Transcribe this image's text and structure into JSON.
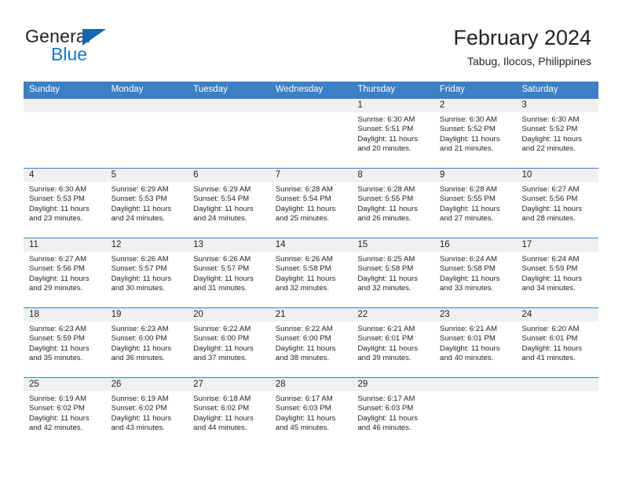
{
  "brand": {
    "name_top": "General",
    "name_bottom": "Blue",
    "triangle_color": "#1565b0",
    "blue_color": "#1877c4"
  },
  "header": {
    "title": "February 2024",
    "subtitle": "Tabug, Ilocos, Philippines"
  },
  "theme": {
    "header_bar_color": "#3b7fc4",
    "daynum_band_color": "#f0f0f0",
    "text_color": "#231f20"
  },
  "weekdays": [
    "Sunday",
    "Monday",
    "Tuesday",
    "Wednesday",
    "Thursday",
    "Friday",
    "Saturday"
  ],
  "weeks": [
    [
      {
        "day": "",
        "sunrise": "",
        "sunset": "",
        "daylight_line1": "",
        "daylight_line2": ""
      },
      {
        "day": "",
        "sunrise": "",
        "sunset": "",
        "daylight_line1": "",
        "daylight_line2": ""
      },
      {
        "day": "",
        "sunrise": "",
        "sunset": "",
        "daylight_line1": "",
        "daylight_line2": ""
      },
      {
        "day": "",
        "sunrise": "",
        "sunset": "",
        "daylight_line1": "",
        "daylight_line2": ""
      },
      {
        "day": "1",
        "sunrise": "Sunrise: 6:30 AM",
        "sunset": "Sunset: 5:51 PM",
        "daylight_line1": "Daylight: 11 hours",
        "daylight_line2": "and 20 minutes."
      },
      {
        "day": "2",
        "sunrise": "Sunrise: 6:30 AM",
        "sunset": "Sunset: 5:52 PM",
        "daylight_line1": "Daylight: 11 hours",
        "daylight_line2": "and 21 minutes."
      },
      {
        "day": "3",
        "sunrise": "Sunrise: 6:30 AM",
        "sunset": "Sunset: 5:52 PM",
        "daylight_line1": "Daylight: 11 hours",
        "daylight_line2": "and 22 minutes."
      }
    ],
    [
      {
        "day": "4",
        "sunrise": "Sunrise: 6:30 AM",
        "sunset": "Sunset: 5:53 PM",
        "daylight_line1": "Daylight: 11 hours",
        "daylight_line2": "and 23 minutes."
      },
      {
        "day": "5",
        "sunrise": "Sunrise: 6:29 AM",
        "sunset": "Sunset: 5:53 PM",
        "daylight_line1": "Daylight: 11 hours",
        "daylight_line2": "and 24 minutes."
      },
      {
        "day": "6",
        "sunrise": "Sunrise: 6:29 AM",
        "sunset": "Sunset: 5:54 PM",
        "daylight_line1": "Daylight: 11 hours",
        "daylight_line2": "and 24 minutes."
      },
      {
        "day": "7",
        "sunrise": "Sunrise: 6:28 AM",
        "sunset": "Sunset: 5:54 PM",
        "daylight_line1": "Daylight: 11 hours",
        "daylight_line2": "and 25 minutes."
      },
      {
        "day": "8",
        "sunrise": "Sunrise: 6:28 AM",
        "sunset": "Sunset: 5:55 PM",
        "daylight_line1": "Daylight: 11 hours",
        "daylight_line2": "and 26 minutes."
      },
      {
        "day": "9",
        "sunrise": "Sunrise: 6:28 AM",
        "sunset": "Sunset: 5:55 PM",
        "daylight_line1": "Daylight: 11 hours",
        "daylight_line2": "and 27 minutes."
      },
      {
        "day": "10",
        "sunrise": "Sunrise: 6:27 AM",
        "sunset": "Sunset: 5:56 PM",
        "daylight_line1": "Daylight: 11 hours",
        "daylight_line2": "and 28 minutes."
      }
    ],
    [
      {
        "day": "11",
        "sunrise": "Sunrise: 6:27 AM",
        "sunset": "Sunset: 5:56 PM",
        "daylight_line1": "Daylight: 11 hours",
        "daylight_line2": "and 29 minutes."
      },
      {
        "day": "12",
        "sunrise": "Sunrise: 6:26 AM",
        "sunset": "Sunset: 5:57 PM",
        "daylight_line1": "Daylight: 11 hours",
        "daylight_line2": "and 30 minutes."
      },
      {
        "day": "13",
        "sunrise": "Sunrise: 6:26 AM",
        "sunset": "Sunset: 5:57 PM",
        "daylight_line1": "Daylight: 11 hours",
        "daylight_line2": "and 31 minutes."
      },
      {
        "day": "14",
        "sunrise": "Sunrise: 6:26 AM",
        "sunset": "Sunset: 5:58 PM",
        "daylight_line1": "Daylight: 11 hours",
        "daylight_line2": "and 32 minutes."
      },
      {
        "day": "15",
        "sunrise": "Sunrise: 6:25 AM",
        "sunset": "Sunset: 5:58 PM",
        "daylight_line1": "Daylight: 11 hours",
        "daylight_line2": "and 32 minutes."
      },
      {
        "day": "16",
        "sunrise": "Sunrise: 6:24 AM",
        "sunset": "Sunset: 5:58 PM",
        "daylight_line1": "Daylight: 11 hours",
        "daylight_line2": "and 33 minutes."
      },
      {
        "day": "17",
        "sunrise": "Sunrise: 6:24 AM",
        "sunset": "Sunset: 5:59 PM",
        "daylight_line1": "Daylight: 11 hours",
        "daylight_line2": "and 34 minutes."
      }
    ],
    [
      {
        "day": "18",
        "sunrise": "Sunrise: 6:23 AM",
        "sunset": "Sunset: 5:59 PM",
        "daylight_line1": "Daylight: 11 hours",
        "daylight_line2": "and 35 minutes."
      },
      {
        "day": "19",
        "sunrise": "Sunrise: 6:23 AM",
        "sunset": "Sunset: 6:00 PM",
        "daylight_line1": "Daylight: 11 hours",
        "daylight_line2": "and 36 minutes."
      },
      {
        "day": "20",
        "sunrise": "Sunrise: 6:22 AM",
        "sunset": "Sunset: 6:00 PM",
        "daylight_line1": "Daylight: 11 hours",
        "daylight_line2": "and 37 minutes."
      },
      {
        "day": "21",
        "sunrise": "Sunrise: 6:22 AM",
        "sunset": "Sunset: 6:00 PM",
        "daylight_line1": "Daylight: 11 hours",
        "daylight_line2": "and 38 minutes."
      },
      {
        "day": "22",
        "sunrise": "Sunrise: 6:21 AM",
        "sunset": "Sunset: 6:01 PM",
        "daylight_line1": "Daylight: 11 hours",
        "daylight_line2": "and 39 minutes."
      },
      {
        "day": "23",
        "sunrise": "Sunrise: 6:21 AM",
        "sunset": "Sunset: 6:01 PM",
        "daylight_line1": "Daylight: 11 hours",
        "daylight_line2": "and 40 minutes."
      },
      {
        "day": "24",
        "sunrise": "Sunrise: 6:20 AM",
        "sunset": "Sunset: 6:01 PM",
        "daylight_line1": "Daylight: 11 hours",
        "daylight_line2": "and 41 minutes."
      }
    ],
    [
      {
        "day": "25",
        "sunrise": "Sunrise: 6:19 AM",
        "sunset": "Sunset: 6:02 PM",
        "daylight_line1": "Daylight: 11 hours",
        "daylight_line2": "and 42 minutes."
      },
      {
        "day": "26",
        "sunrise": "Sunrise: 6:19 AM",
        "sunset": "Sunset: 6:02 PM",
        "daylight_line1": "Daylight: 11 hours",
        "daylight_line2": "and 43 minutes."
      },
      {
        "day": "27",
        "sunrise": "Sunrise: 6:18 AM",
        "sunset": "Sunset: 6:02 PM",
        "daylight_line1": "Daylight: 11 hours",
        "daylight_line2": "and 44 minutes."
      },
      {
        "day": "28",
        "sunrise": "Sunrise: 6:17 AM",
        "sunset": "Sunset: 6:03 PM",
        "daylight_line1": "Daylight: 11 hours",
        "daylight_line2": "and 45 minutes."
      },
      {
        "day": "29",
        "sunrise": "Sunrise: 6:17 AM",
        "sunset": "Sunset: 6:03 PM",
        "daylight_line1": "Daylight: 11 hours",
        "daylight_line2": "and 46 minutes."
      },
      {
        "day": "",
        "sunrise": "",
        "sunset": "",
        "daylight_line1": "",
        "daylight_line2": ""
      },
      {
        "day": "",
        "sunrise": "",
        "sunset": "",
        "daylight_line1": "",
        "daylight_line2": ""
      }
    ]
  ]
}
